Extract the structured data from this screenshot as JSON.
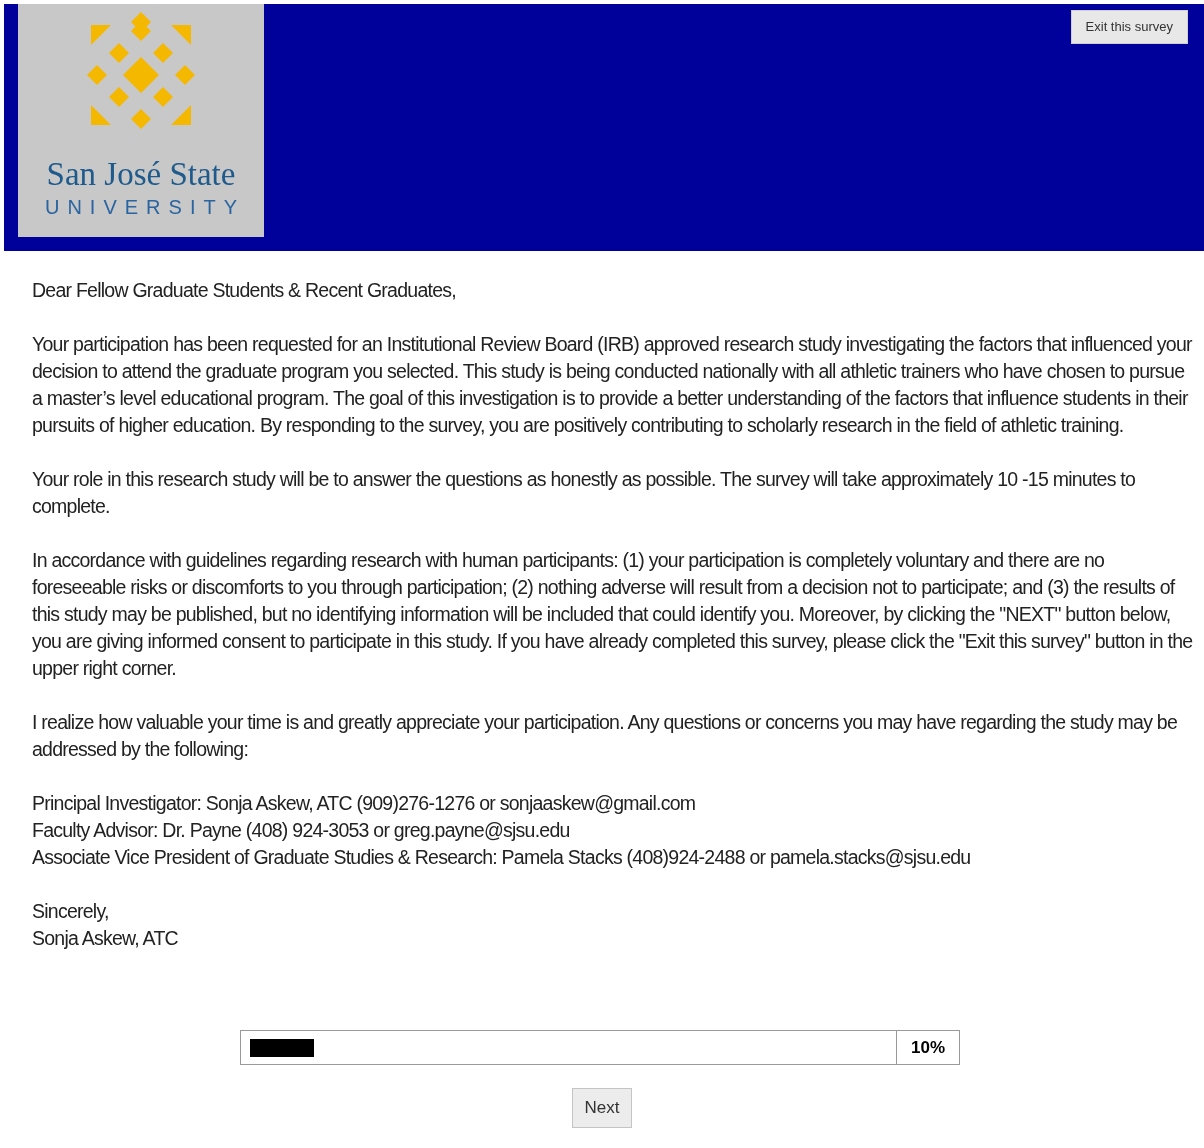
{
  "header": {
    "logo": {
      "name": "San José State",
      "subtitle": "UNIVERSITY"
    },
    "exit_button": "Exit this survey"
  },
  "greeting": "Dear Fellow Graduate Students & Recent Graduates,",
  "paragraphs": [
    "Your participation has been requested for an Institutional Review Board (IRB) approved research study investigating the factors that influenced your decision to attend the graduate program you selected. This study is being conducted nationally with all athletic trainers who have chosen to pursue a master’s level educational program. The goal of this investigation is to provide a better understanding of the factors that influence students in their pursuits of higher education. By responding to the survey, you are positively contributing to scholarly research in the field of athletic training.",
    "Your role in this research study will be to answer the questions as honestly as possible. The survey will take approximately 10 -15 minutes to complete.",
    "In accordance with guidelines regarding research with human participants: (1) your participation is completely voluntary and there are no foreseeable risks or discomforts to you through participation; (2) nothing adverse will result from a decision not to participate; and (3) the results of this study may be published, but no identifying information will be included that could identify you. Moreover, by clicking the \"NEXT\" button below, you are giving informed consent to participate in this study. If you have already completed this survey, please click the \"Exit this survey\" button in the upper right corner.",
    "I realize how valuable your time is and greatly appreciate your participation. Any questions or concerns you may have regarding the study may be addressed by the following:"
  ],
  "contacts": [
    "Principal Investigator: Sonja Askew, ATC (909)276-1276 or sonjaaskew@gmail.com",
    "Faculty Advisor: Dr. Payne (408) 924-3053 or greg.payne@sjsu.edu",
    "Associate Vice President of Graduate Studies & Research: Pamela Stacks (408)924-2488 or pamela.stacks@sjsu.edu"
  ],
  "closing": [
    "Sincerely,",
    "Sonja Askew, ATC"
  ],
  "progress": {
    "level": 0.1,
    "reading": "10%"
  },
  "next_button": "Next"
}
